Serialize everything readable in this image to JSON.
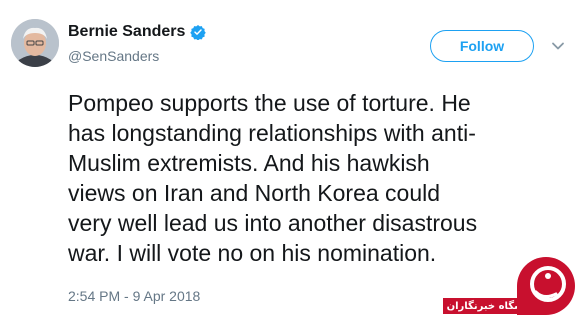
{
  "tweet": {
    "author_name": "Bernie Sanders",
    "handle": "@SenSanders",
    "follow_label": "Follow",
    "text_lines": [
      "Pompeo supports the use of torture. He",
      "has longstanding relationships with anti-",
      "Muslim extremists. And his hawkish",
      "views on Iran and North Korea could",
      "very well lead us into another disastrous",
      "war. I will vote no on his nomination."
    ],
    "timestamp": "2:54 PM - 9 Apr 2018"
  },
  "watermark": {
    "text": "باشگاه خبرنگاران"
  },
  "colors": {
    "accent": "#1da1f2",
    "text": "#14171a",
    "secondary": "#657786",
    "watermark_red": "#c8102e"
  },
  "icons": {
    "verified": "verified-badge-icon",
    "chevron": "chevron-down-icon"
  }
}
